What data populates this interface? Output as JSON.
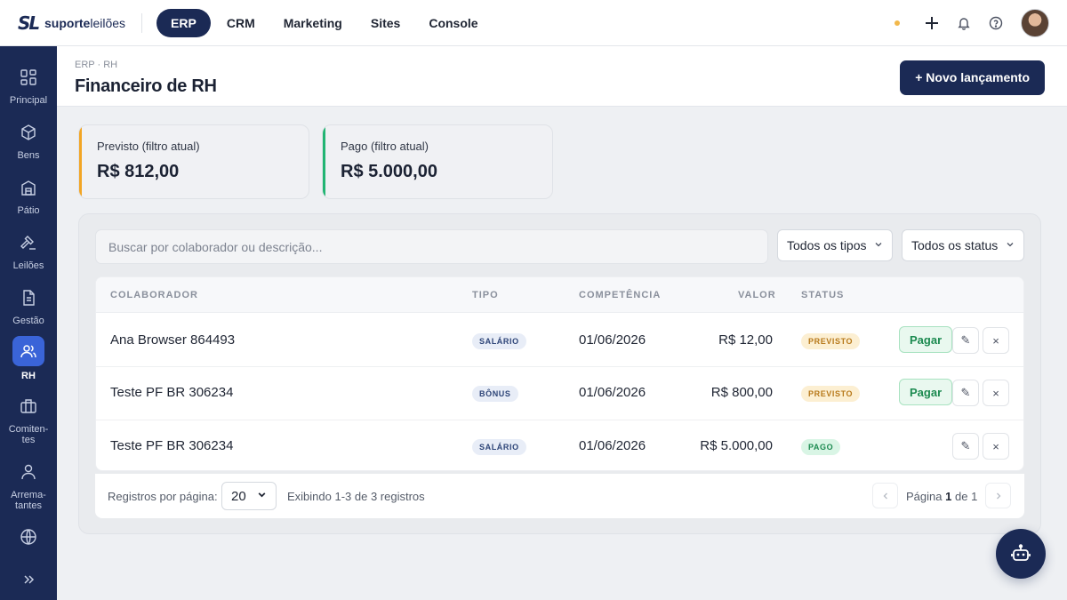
{
  "brand": {
    "mark": "SL",
    "name_bold": "suporte",
    "name_rest": "leilões"
  },
  "topnav": [
    {
      "label": "ERP",
      "active": true
    },
    {
      "label": "CRM",
      "active": false
    },
    {
      "label": "Marketing",
      "active": false
    },
    {
      "label": "Sites",
      "active": false
    },
    {
      "label": "Console",
      "active": false
    }
  ],
  "topright_icons": [
    "status-dot",
    "plus-icon",
    "bell-icon",
    "help-icon",
    "user-avatar"
  ],
  "sidebar": {
    "items": [
      {
        "label": "Principal",
        "icon": "grid-icon"
      },
      {
        "label": "Bens",
        "icon": "box-icon"
      },
      {
        "label": "Pátio",
        "icon": "building-icon"
      },
      {
        "label": "Leilões",
        "icon": "gavel-icon"
      },
      {
        "label": "Gestão",
        "icon": "document-icon"
      },
      {
        "label": "RH",
        "icon": "users-icon",
        "active": true
      },
      {
        "label": "Comiten-tes",
        "icon": "briefcase-icon"
      },
      {
        "label": "Arrema-tantes",
        "icon": "person-icon"
      },
      {
        "label": "",
        "icon": "globe-icon"
      }
    ],
    "expand_icon": "chevrons-right-icon"
  },
  "page": {
    "breadcrumb": "ERP · RH",
    "title": "Financeiro de RH",
    "new_button": "+ Novo lançamento"
  },
  "cards": [
    {
      "label": "Previsto (filtro atual)",
      "value": "R$ 812,00",
      "accent": "#f2a524"
    },
    {
      "label": "Pago (filtro atual)",
      "value": "R$ 5.000,00",
      "accent": "#22b573"
    }
  ],
  "filters": {
    "search_placeholder": "Buscar por colaborador ou descrição...",
    "type_select": "Todos os tipos",
    "status_select": "Todos os status"
  },
  "table": {
    "headers": [
      "COLABORADOR",
      "TIPO",
      "COMPETÊNCIA",
      "VALOR",
      "STATUS"
    ],
    "rows": [
      {
        "colaborador": "Ana Browser 864493",
        "tipo": "SALÁRIO",
        "competencia": "01/06/2026",
        "valor": "R$ 12,00",
        "status": "PREVISTO",
        "pagar": "Pagar"
      },
      {
        "colaborador": "Teste PF BR 306234",
        "tipo": "BÔNUS",
        "competencia": "01/06/2026",
        "valor": "R$ 800,00",
        "status": "PREVISTO",
        "pagar": "Pagar"
      },
      {
        "colaborador": "Teste PF BR 306234",
        "tipo": "SALÁRIO",
        "competencia": "01/06/2026",
        "valor": "R$ 5.000,00",
        "status": "PAGO",
        "pagar": ""
      }
    ],
    "edit_glyph": "✎",
    "delete_glyph": "×"
  },
  "pagination": {
    "per_page_label": "Registros por página:",
    "per_page_value": "20",
    "info": "Exibindo 1-3 de 3 registros",
    "page_prefix": "Página",
    "page_current": "1",
    "page_sep": "de",
    "page_total": "1"
  },
  "colors": {
    "primary": "#1b2a55",
    "active_sidebar": "#3a64d8"
  }
}
